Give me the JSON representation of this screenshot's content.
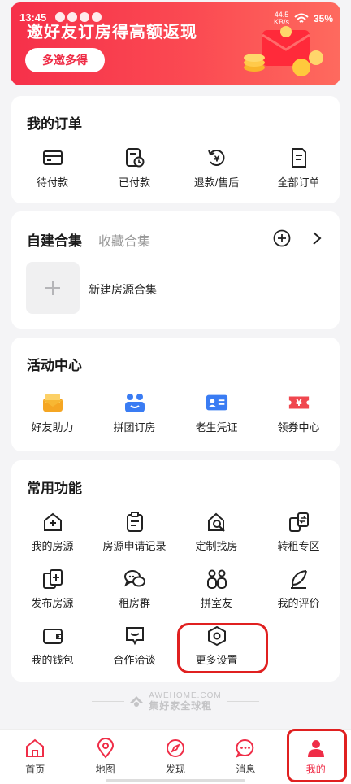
{
  "status_bar": {
    "time": "13:45",
    "net_speed_value": "44.5",
    "net_speed_unit": "KB/s",
    "battery": "35%"
  },
  "banner": {
    "title": "邀好友订房得高额返现",
    "button": "多邀多得"
  },
  "orders": {
    "title": "我的订单",
    "items": [
      {
        "label": "待付款",
        "icon": "wallet-icon"
      },
      {
        "label": "已付款",
        "icon": "paid-clock-icon"
      },
      {
        "label": "退款/售后",
        "icon": "refund-icon"
      },
      {
        "label": "全部订单",
        "icon": "orders-list-icon"
      }
    ]
  },
  "collections": {
    "tab_active": "自建合集",
    "tab_inactive": "收藏合集",
    "new_label": "新建房源合集"
  },
  "activities": {
    "title": "活动中心",
    "items": [
      {
        "label": "好友助力",
        "icon": "envelope-icon",
        "color": "#f5a623"
      },
      {
        "label": "拼团订房",
        "icon": "group-icon",
        "color": "#3a7cf3"
      },
      {
        "label": "老生凭证",
        "icon": "id-card-icon",
        "color": "#3a7cf3"
      },
      {
        "label": "领券中心",
        "icon": "coupon-icon",
        "color": "#f0474f"
      }
    ]
  },
  "functions": {
    "title": "常用功能",
    "rows": [
      [
        {
          "label": "我的房源",
          "icon": "house-plus-icon"
        },
        {
          "label": "房源申请记录",
          "icon": "clipboard-icon"
        },
        {
          "label": "定制找房",
          "icon": "house-search-icon"
        },
        {
          "label": "转租专区",
          "icon": "transfer-icon"
        }
      ],
      [
        {
          "label": "发布房源",
          "icon": "publish-icon"
        },
        {
          "label": "租房群",
          "icon": "chat-group-icon"
        },
        {
          "label": "拼室友",
          "icon": "roommates-icon"
        },
        {
          "label": "我的评价",
          "icon": "feather-icon"
        }
      ],
      [
        {
          "label": "我的钱包",
          "icon": "wallet-icon"
        },
        {
          "label": "合作洽谈",
          "icon": "message-icon"
        },
        {
          "label": "更多设置",
          "icon": "settings-hex-icon"
        }
      ]
    ]
  },
  "footer_logo": {
    "line1": "AWEHOME.COM",
    "line2": "集好家全球租"
  },
  "tabbar": [
    {
      "label": "首页",
      "icon": "home-icon"
    },
    {
      "label": "地图",
      "icon": "map-pin-icon"
    },
    {
      "label": "发现",
      "icon": "compass-icon"
    },
    {
      "label": "消息",
      "icon": "message-dots-icon"
    },
    {
      "label": "我的",
      "icon": "person-icon",
      "active": true
    }
  ],
  "colors": {
    "accent": "#ef2d47",
    "highlight": "#e02020"
  }
}
